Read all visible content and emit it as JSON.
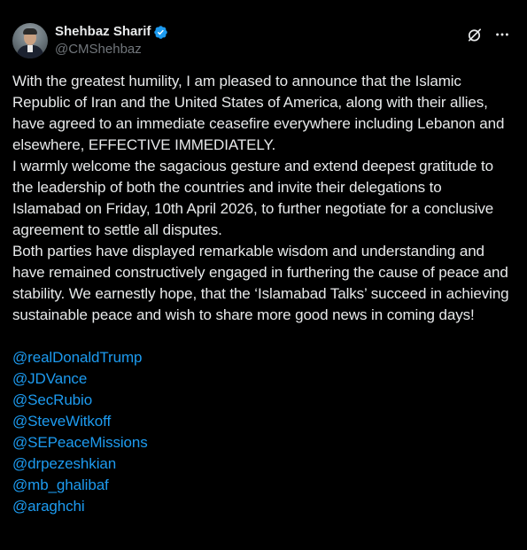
{
  "author": {
    "display_name": "Shehbaz Sharif",
    "handle": "@CMShehbaz",
    "verified_icon": "verified-badge-icon",
    "verified_color": "#1d9bf0"
  },
  "actions": {
    "grok_icon": "grok-icon",
    "more_icon": "more-dots-icon"
  },
  "paragraphs": [
    "With the greatest humility, I am pleased to announce that the Islamic Republic of Iran and the United States of America, along with their allies, have agreed to an immediate ceasefire everywhere including Lebanon and elsewhere, EFFECTIVE IMMEDIATELY.",
    "I warmly welcome the sagacious gesture and extend deepest gratitude to the leadership of both the countries and invite their delegations to Islamabad on Friday, 10th April 2026, to further negotiate for a conclusive agreement to settle all disputes.",
    "Both parties have displayed remarkable wisdom and understanding and have remained constructively engaged in furthering the cause of peace and stability. We earnestly hope, that the ‘Islamabad Talks’ succeed in achieving sustainable peace and wish to share more good news in coming days!"
  ],
  "mentions": [
    "@realDonaldTrump",
    "@JDVance",
    "@SecRubio",
    "@SteveWitkoff",
    "@SEPeaceMissions",
    "@drpezeshkian",
    "@mb_ghalibaf",
    "@araghchi"
  ],
  "colors": {
    "background": "#000000",
    "text": "#e7e9ea",
    "secondary_text": "#71767b",
    "link": "#1d9bf0"
  }
}
